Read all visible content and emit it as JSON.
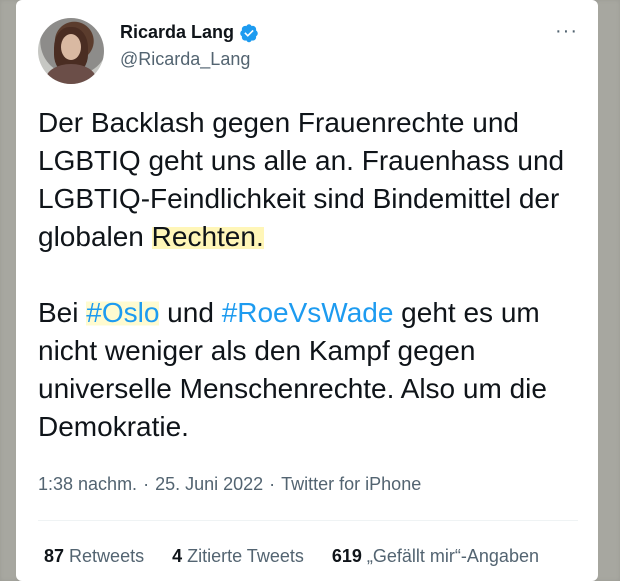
{
  "tweet": {
    "author_name": "Ricarda Lang",
    "handle": "@Ricarda_Lang",
    "more_label": "···",
    "para1": {
      "before": "Der Backlash gegen Frauenrechte und LGBTIQ geht uns alle an. Frauenhass und LGBTIQ-Feindlichkeit sind Bindemittel der globalen ",
      "highlight": "Rechten."
    },
    "para2": {
      "prefix": "Bei ",
      "hashtag1": "#Oslo",
      "middle": " und ",
      "hashtag2": "#RoeVsWade",
      "suffix": " geht es um nicht weniger als den Kampf gegen universelle Menschenrechte. Also um die Demokratie."
    },
    "time": "1:38 nachm.",
    "date": "25. Juni 2022",
    "source": "Twitter for iPhone",
    "separator": "·"
  },
  "stats": {
    "retweets_count": "87",
    "retweets_label": "Retweets",
    "quotes_count": "4",
    "quotes_label": "Zitierte Tweets",
    "likes_count": "619",
    "likes_label": "„Gefällt mir“-Angaben"
  },
  "colors": {
    "accent": "#1d9bf0",
    "highlight": "#fff6b8",
    "text": "#0f1419",
    "secondary": "#536471"
  }
}
